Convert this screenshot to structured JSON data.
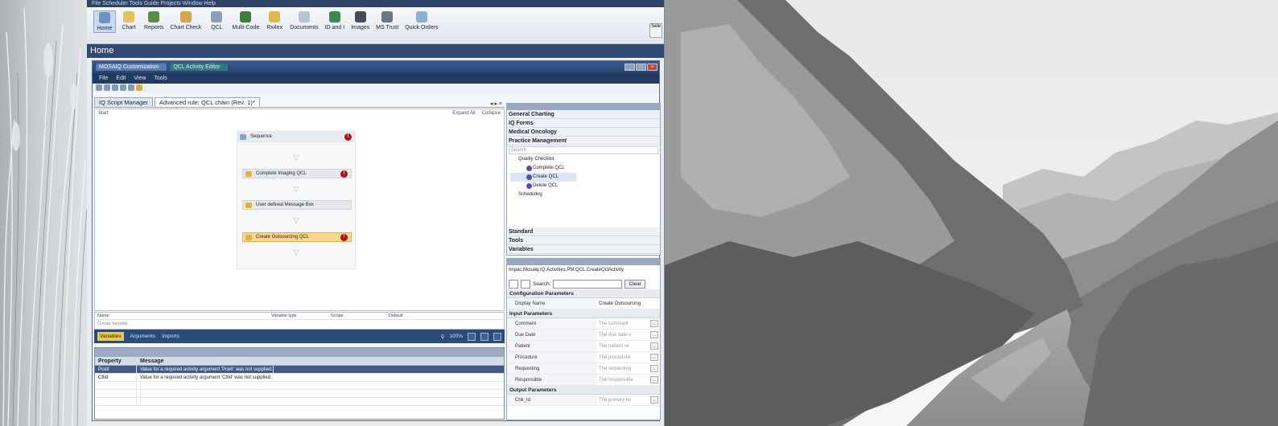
{
  "menubar": {
    "text": "File  Scheduler  Tools  Guide Projects  Window  Help"
  },
  "ribbon": {
    "buttons": [
      {
        "label": "Home"
      },
      {
        "label": "Chart"
      },
      {
        "label": "Reports"
      },
      {
        "label": "Chart Check"
      },
      {
        "label": "QCL"
      },
      {
        "label": "Multi-Code"
      },
      {
        "label": "Rx4ex"
      },
      {
        "label": "Documents"
      },
      {
        "label": "ID and I"
      },
      {
        "label": "Images"
      },
      {
        "label": "MS Trust"
      },
      {
        "label": "Quick Orders"
      }
    ],
    "side_label": "Sele"
  },
  "home_title": "Home",
  "subwindow": {
    "tab_a": "MOSAIQ Customization",
    "tab_b": "QCL Activity Editor",
    "menu": [
      "File",
      "Edit",
      "View",
      "Tools"
    ],
    "doc_tabs": [
      "IQ Script Manager",
      "Advanced rule: QCL chain (Rev: 1)*"
    ],
    "doc_tab_ctl": "◂ ▸ ×"
  },
  "designer": {
    "left_label": "Start",
    "expand_all": "Expand All",
    "collapse": "Collapse",
    "sequence": "Sequence",
    "activities": [
      "Complete Imaging QCL",
      "User defined Message Box",
      "Create Outsourcing QCL"
    ],
    "error_glyph": "!"
  },
  "variables": {
    "columns": [
      "Name",
      "Variable type",
      "Scope",
      "Default"
    ],
    "create": "Create Variable"
  },
  "bottombar": {
    "variables": "Variables",
    "arguments": "Arguments",
    "imports": "Imports",
    "zoom": "100%"
  },
  "errors": {
    "columns": [
      "Property",
      "Message"
    ],
    "rows": [
      {
        "property": "PcetI",
        "message": "Value for a required activity argument 'PcetI' was not supplied."
      },
      {
        "property": "CtlId",
        "message": "Value for a required activity argument 'CtlId' was not supplied."
      }
    ]
  },
  "toolbox": {
    "categories_top": [
      "General Charting",
      "IQ Forms",
      "Medical Oncology",
      "Practice Management"
    ],
    "search": "Search",
    "tree": {
      "root": "Quality Checklist",
      "items": [
        "Complete QCL",
        "Create QCL",
        "Delete QCL"
      ],
      "other": "Scheduling"
    },
    "categories_bottom": [
      "Standard",
      "Tools",
      "Variables"
    ]
  },
  "properties": {
    "type": "Impac.Mosaiq.IQ.Activities.PM.QCL.CreateQclActivity",
    "search_label": "Search:",
    "clear": "Clear",
    "sections": {
      "config": "Configuration Parameters",
      "input": "Input Parameters",
      "output": "Output Parameters"
    },
    "display_name": {
      "name": "Display Name",
      "value": "Create Outsourcing"
    },
    "inputs": [
      {
        "name": "Comment",
        "value": "The comment"
      },
      {
        "name": "Due Date",
        "value": "The due date o"
      },
      {
        "name": "Patient",
        "value": "The patient wi"
      },
      {
        "name": "Procedure",
        "value": "The procedure"
      },
      {
        "name": "Requesting",
        "value": "The requesting"
      },
      {
        "name": "Responsible",
        "value": "The responsible"
      }
    ],
    "outputs": [
      {
        "name": "Chk_Id",
        "value": "The primary ke"
      }
    ]
  },
  "colors": {
    "navy": "#2f4a75",
    "error": "#b4101a",
    "highlight": "#f5d98a"
  }
}
